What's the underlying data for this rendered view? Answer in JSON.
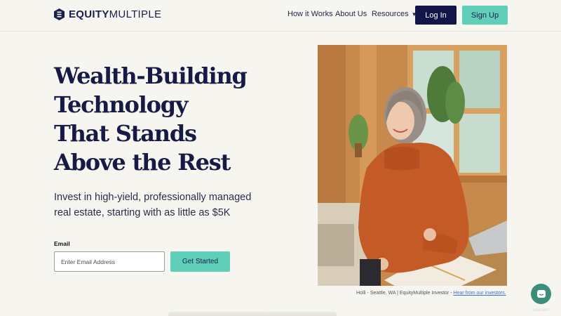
{
  "header": {
    "logo_bold": "EQUITY",
    "logo_light": "MULTIPLE",
    "nav": {
      "how_it_works": "How it Works",
      "about_us": "About Us",
      "resources": "Resources"
    },
    "login_label": "Log In",
    "signup_label": "Sign Up"
  },
  "hero": {
    "headline_lines": [
      "Wealth-Building",
      "Technology",
      "That Stands",
      "Above the Rest"
    ],
    "subhead_lines": [
      "Invest in high-yield, professionally managed",
      "real estate, starting with as little as $5K"
    ],
    "email_label": "Email",
    "email_placeholder": "Enter Email Address",
    "email_value": "",
    "cta_label": "Get Started"
  },
  "photo": {
    "caption_text": "Holli - Seattle, WA | EquityMultiple Investor - ",
    "caption_link": "Hear from our investors."
  },
  "watermark": "eaa.com",
  "colors": {
    "navy": "#111547",
    "teal": "#5fcfba",
    "background": "#f6f5f0",
    "chat": "#3b8f7a"
  }
}
